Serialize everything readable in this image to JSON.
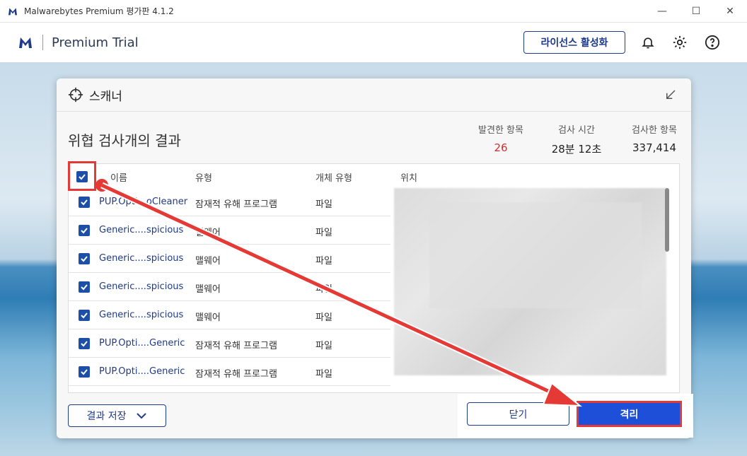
{
  "window": {
    "title": "Malwarebytes Premium 평가판  4.1.2",
    "minimize_icon": "minimize-icon",
    "maximize_icon": "maximize-icon",
    "close_icon": "close-icon"
  },
  "header": {
    "product": "Premium Trial",
    "license_label": "라이선스 활성화",
    "icons": [
      "bell-icon",
      "gear-icon",
      "help-icon"
    ]
  },
  "dialog": {
    "title": "스캐너",
    "results_title": "위협 검사개의 결과",
    "stats": [
      {
        "label": "발견한 항목",
        "value": "26",
        "color": "#d32f2f"
      },
      {
        "label": "검사 시간",
        "value": "28분 12초"
      },
      {
        "label": "검사한 항목",
        "value": "337,414"
      }
    ],
    "columns": [
      "이름",
      "유형",
      "개체 유형",
      "위치"
    ],
    "rows": [
      {
        "name": "PUP.Opti...oCleaner",
        "type": "잠재적 유해 프로그램",
        "otype": "파일"
      },
      {
        "name": "Generic....spicious",
        "type": "맬웨어",
        "otype": "파일"
      },
      {
        "name": "Generic....spicious",
        "type": "맬웨어",
        "otype": "파일"
      },
      {
        "name": "Generic....spicious",
        "type": "맬웨어",
        "otype": "파일"
      },
      {
        "name": "Generic....spicious",
        "type": "맬웨어",
        "otype": "파일"
      },
      {
        "name": "PUP.Opti....Generic",
        "type": "잠재적 유해 프로그램",
        "otype": "파일"
      },
      {
        "name": "PUP.Opti....Generic",
        "type": "잠재적 유해 프로그램",
        "otype": "파일"
      }
    ],
    "save_label": "결과 저장",
    "close_label": "닫기",
    "quarantine_label": "격리"
  },
  "colors": {
    "brand": "#1e3a8a",
    "accent": "#1e4fd8",
    "highlight": "#e53935"
  }
}
